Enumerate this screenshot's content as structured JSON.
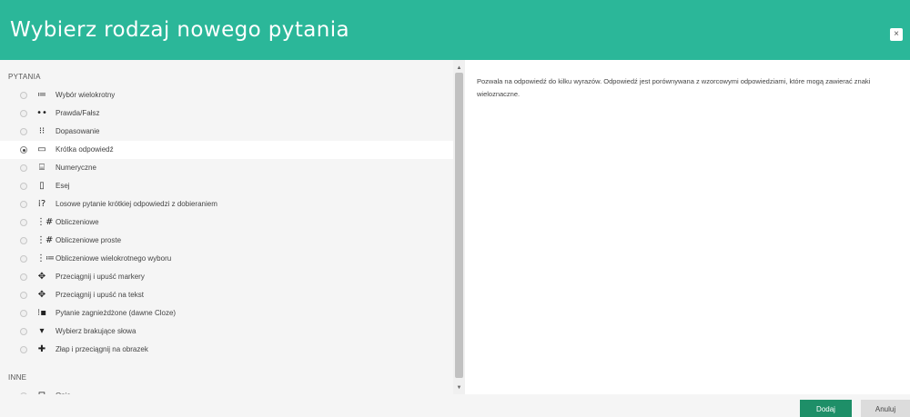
{
  "dialog": {
    "title": "Wybierz rodzaj nowego pytania",
    "close_label": "×"
  },
  "questions": {
    "section_label": "PYTANIA",
    "items": [
      {
        "label": "Wybór wielokrotny",
        "icon": "≔",
        "icon_name": "multichoice-icon"
      },
      {
        "label": "Prawda/Fałsz",
        "icon": "••",
        "icon_name": "truefalse-icon"
      },
      {
        "label": "Dopasowanie",
        "icon": "⁝⁝",
        "icon_name": "matching-icon"
      },
      {
        "label": "Krótka odpowiedź",
        "icon": "▭",
        "icon_name": "shortanswer-icon",
        "selected": true
      },
      {
        "label": "Numeryczne",
        "icon": "⌸",
        "icon_name": "numerical-icon"
      },
      {
        "label": "Esej",
        "icon": "▯",
        "icon_name": "essay-icon"
      },
      {
        "label": "Losowe pytanie krótkiej odpowiedzi z dobieraniem",
        "icon": "⁞?",
        "icon_name": "randomsamatch-icon"
      },
      {
        "label": "Obliczeniowe",
        "icon": "⋮#",
        "icon_name": "calculated-icon"
      },
      {
        "label": "Obliczeniowe proste",
        "icon": "⋮#",
        "icon_name": "calculatedsimple-icon"
      },
      {
        "label": "Obliczeniowe wielokrotnego wyboru",
        "icon": "⋮≔",
        "icon_name": "calculatedmulti-icon"
      },
      {
        "label": "Przeciągnij i upuść markery",
        "icon": "✥",
        "icon_name": "ddmarker-icon"
      },
      {
        "label": "Przeciągnij i upuść na tekst",
        "icon": "✥",
        "icon_name": "ddwtos-icon"
      },
      {
        "label": "Pytanie zagnieżdżone (dawne Cloze)",
        "icon": "⁝▪",
        "icon_name": "multianswer-icon"
      },
      {
        "label": "Wybierz brakujące słowa",
        "icon": "▾",
        "icon_name": "gapselect-icon"
      },
      {
        "label": "Złap i przeciągnij na obrazek",
        "icon": "✚",
        "icon_name": "ddimageortext-icon"
      }
    ]
  },
  "other": {
    "section_label": "INNE",
    "items": [
      {
        "label": "Opis",
        "icon": "⊟",
        "icon_name": "description-icon"
      }
    ]
  },
  "description": "Pozwala na odpowiedź do kilku wyrazów. Odpowiedź jest porównywana z wzorcowymi odpowiedziami, które mogą zawierać znaki wieloznaczne.",
  "footer": {
    "add_label": "Dodaj",
    "cancel_label": "Anuluj"
  },
  "colors": {
    "header": "#2bb799",
    "add_button": "#1e8f68"
  }
}
